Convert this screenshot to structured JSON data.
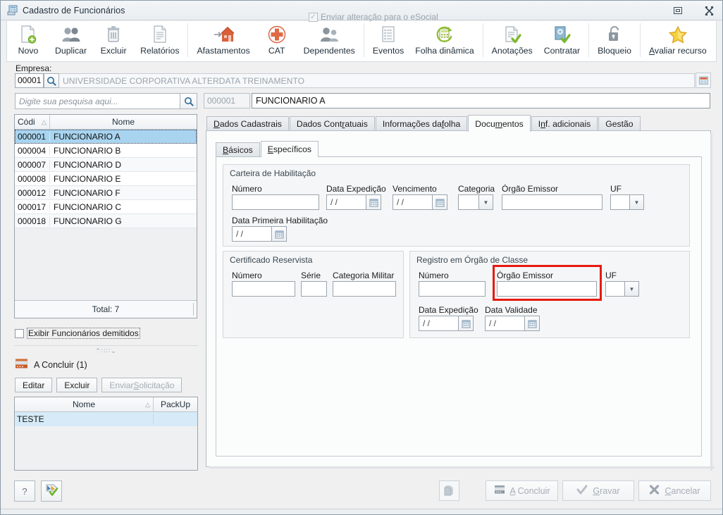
{
  "window": {
    "title": "Cadastro de Funcionários",
    "icon": "app-window-icon",
    "restore_label": "❐",
    "close_label": "✖"
  },
  "toolbar": {
    "groups": [
      {
        "items": [
          {
            "label": "Novo",
            "icon": "new-document-icon",
            "accel": ""
          },
          {
            "label": "Duplicar",
            "icon": "duplicate-users-icon",
            "accel": ""
          },
          {
            "label": "Excluir",
            "icon": "trash-icon",
            "accel": ""
          },
          {
            "label": "Relatórios",
            "icon": "report-document-icon",
            "accel": ""
          }
        ]
      },
      {
        "items": [
          {
            "label": "Afastamentos",
            "icon": "leave-house-icon",
            "accel": ""
          },
          {
            "label": "CAT",
            "icon": "red-cross-icon",
            "accel": ""
          },
          {
            "label": "Dependentes",
            "icon": "dependents-users-icon",
            "accel": ""
          }
        ]
      },
      {
        "items": [
          {
            "label": "Eventos",
            "icon": "list-events-icon",
            "accel": ""
          },
          {
            "label": "Folha dinâmica",
            "icon": "calculator-refresh-icon",
            "accel": ""
          }
        ]
      },
      {
        "items": [
          {
            "label": "Anotações",
            "icon": "note-check-icon",
            "accel": ""
          },
          {
            "label": "Contratar",
            "icon": "hire-check-icon",
            "accel": ""
          }
        ]
      },
      {
        "items": [
          {
            "label": "Bloqueio",
            "icon": "padlock-open-icon",
            "accel": ""
          }
        ]
      },
      {
        "items": [
          {
            "label": "Avaliar recurso",
            "icon": "star-icon",
            "accel": "A"
          }
        ]
      }
    ]
  },
  "company": {
    "label": "Empresa:",
    "code": "00001",
    "name": "UNIVERSIDADE CORPORATIVA ALTERDATA TREINAMENTO",
    "search_icon": "magnifier-icon",
    "window_icon": "company-window-icon"
  },
  "sidebar": {
    "search": {
      "placeholder": "Digite sua pesquisa aqui...",
      "value": "",
      "button_icon": "magnifier-icon"
    },
    "employee_grid": {
      "columns": [
        "Códi",
        "Nome"
      ],
      "sort_indicator": "△",
      "rows": [
        {
          "code": "000001",
          "name": "FUNCIONARIO A",
          "selected": true
        },
        {
          "code": "000004",
          "name": "FUNCIONARIO B",
          "selected": false
        },
        {
          "code": "000007",
          "name": "FUNCIONARIO D",
          "selected": false
        },
        {
          "code": "000008",
          "name": "FUNCIONARIO E",
          "selected": false
        },
        {
          "code": "000012",
          "name": "FUNCIONARIO F",
          "selected": false
        },
        {
          "code": "000017",
          "name": "FUNCIONARIO C",
          "selected": false
        },
        {
          "code": "000018",
          "name": "FUNCIONARIO G",
          "selected": false
        }
      ],
      "total": "Total: 7"
    },
    "show_dismissed": {
      "label": "Exibir Funcionários demitidos",
      "checked": false
    },
    "splitter_glyph": "⌃∷∷⌄",
    "pending": {
      "icon": "pending-tray-icon",
      "label": "A Concluir (1)",
      "buttons": [
        {
          "label": "Editar",
          "name": "edit-button",
          "disabled": false,
          "accel": ""
        },
        {
          "label": "Excluir",
          "name": "delete-button",
          "disabled": false,
          "accel": ""
        },
        {
          "label": "Enviar Solicitação",
          "name": "send-request-button",
          "disabled": true,
          "accel": "S"
        }
      ],
      "grid": {
        "columns": [
          "Nome",
          "PackUp"
        ],
        "sort_indicator": "△",
        "rows": [
          {
            "name": "TESTE",
            "packup": "",
            "selected": true
          }
        ]
      }
    },
    "help_button": {
      "label": "?",
      "name": "help-button"
    },
    "export_button": {
      "icon": "export-check-icon",
      "name": "export-button"
    }
  },
  "employee": {
    "code": "000001",
    "name": "FUNCIONARIO A"
  },
  "tabs": [
    {
      "label": "Dados Cadastrais",
      "accel_first": "D",
      "active": false
    },
    {
      "label": "Dados Contratuais",
      "accel_first": "r",
      "active": false
    },
    {
      "label": "Informações da folha",
      "accel_first": "f",
      "active": false
    },
    {
      "label": "Documentos",
      "accel_first": "m",
      "active": true
    },
    {
      "label": "Inf. adicionais",
      "accel_first": "n",
      "active": false
    },
    {
      "label": "Gestão",
      "accel_first": "",
      "active": false
    }
  ],
  "subtabs": [
    {
      "label": "Básicos",
      "accel_first": "B",
      "active": false
    },
    {
      "label": "Específicos",
      "accel_first": "E",
      "active": true
    }
  ],
  "groups": {
    "cnh": {
      "title": "Carteira de Habilitação",
      "numero": {
        "label": "Número",
        "value": ""
      },
      "data_expedicao": {
        "label": "Data Expedição",
        "value": "/  /",
        "button_icon": "calendar-icon"
      },
      "vencimento": {
        "label": "Vencimento",
        "value": "/  /",
        "button_icon": "calendar-icon"
      },
      "categoria": {
        "label": "Categoria",
        "value": "",
        "button_icon": "chevron-down-icon"
      },
      "orgao_emissor": {
        "label": "Órgão Emissor",
        "value": ""
      },
      "uf": {
        "label": "UF",
        "value": "",
        "button_icon": "chevron-down-icon"
      },
      "primeira_habilitacao": {
        "label": "Data Primeira Habilitação",
        "value": "/  /",
        "button_icon": "calendar-icon"
      }
    },
    "reservista": {
      "title": "Certificado Reservista",
      "numero": {
        "label": "Número",
        "value": ""
      },
      "serie": {
        "label": "Série",
        "value": ""
      },
      "categoria_militar": {
        "label": "Categoria Militar",
        "value": ""
      }
    },
    "orgao_classe": {
      "title": "Registro em Órgão de Classe",
      "numero": {
        "label": "Número",
        "value": ""
      },
      "orgao_emissor": {
        "label": "Órgão Emissor",
        "value": "",
        "highlight_color": "#e71a0f"
      },
      "uf": {
        "label": "UF",
        "value": "",
        "button_icon": "chevron-down-icon"
      },
      "data_expedicao": {
        "label": "Data Expedição",
        "value": "/  /",
        "button_icon": "calendar-icon"
      },
      "data_validade": {
        "label": "Data Validade",
        "value": "/  /",
        "button_icon": "calendar-icon"
      }
    }
  },
  "footer": {
    "esocial": {
      "label": "Enviar alteração para o eSocial",
      "checked": true,
      "check_glyph": "✓"
    },
    "layers_button": {
      "icon": "layers-icon"
    },
    "buttons": [
      {
        "label": "A Concluir",
        "accel": "A",
        "icon": "tray-icon",
        "name": "a-concluir-button"
      },
      {
        "label": "Gravar",
        "accel": "G",
        "icon": "check-icon",
        "name": "save-button"
      },
      {
        "label": "Cancelar",
        "accel": "C",
        "icon": "x-icon",
        "name": "cancel-button"
      }
    ]
  },
  "colors": {
    "accent_red": "#e71a0f",
    "selection_blue": "#a8d4f0",
    "toolbar_bg": "#ffffff",
    "window_bg": "#f0f0f0"
  }
}
